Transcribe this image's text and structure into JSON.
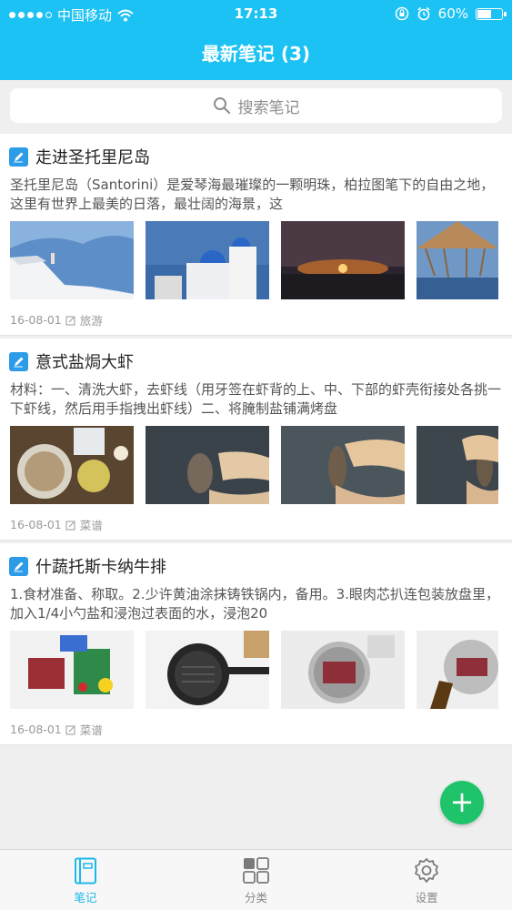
{
  "status_bar": {
    "carrier": "中国移动",
    "time": "17:13",
    "battery": "60%",
    "battery_level": 0.6
  },
  "nav": {
    "title": "最新笔记 (3)"
  },
  "search": {
    "placeholder": "搜索笔记"
  },
  "notes": [
    {
      "title": "走进圣托里尼岛",
      "body": "圣托里尼岛（Santorini）是爱琴海最璀璨的一颗明珠，柏拉图笔下的自由之地，这里有世界上最美的日落，最壮阔的海景，这",
      "date": "16-08-01",
      "category": "旅游"
    },
    {
      "title": "意式盐焗大虾",
      "body": "材料：一、清洗大虾，去虾线（用牙签在虾背的上、中、下部的虾壳衔接处各挑一下虾线，然后用手指拽出虾线）二、将腌制盐铺满烤盘",
      "date": "16-08-01",
      "category": "菜谱"
    },
    {
      "title": "什蔬托斯卡纳牛排",
      "body": "1.食材准备、称取。2.少许黄油涂抹铸铁锅内，备用。3.眼肉芯扒连包装放盘里，加入1/4小勺盐和浸泡过表面的水，浸泡20",
      "date": "16-08-01",
      "category": "菜谱"
    }
  ],
  "tabs": [
    {
      "label": "笔记",
      "icon": "notebook-icon",
      "active": true
    },
    {
      "label": "分类",
      "icon": "grid-icon",
      "active": false
    },
    {
      "label": "设置",
      "icon": "gear-icon",
      "active": false
    }
  ],
  "fab": {
    "label": "+"
  },
  "colors": {
    "accent": "#1cc2f3",
    "fab": "#1fc46a",
    "note_icon": "#2c9be8"
  }
}
